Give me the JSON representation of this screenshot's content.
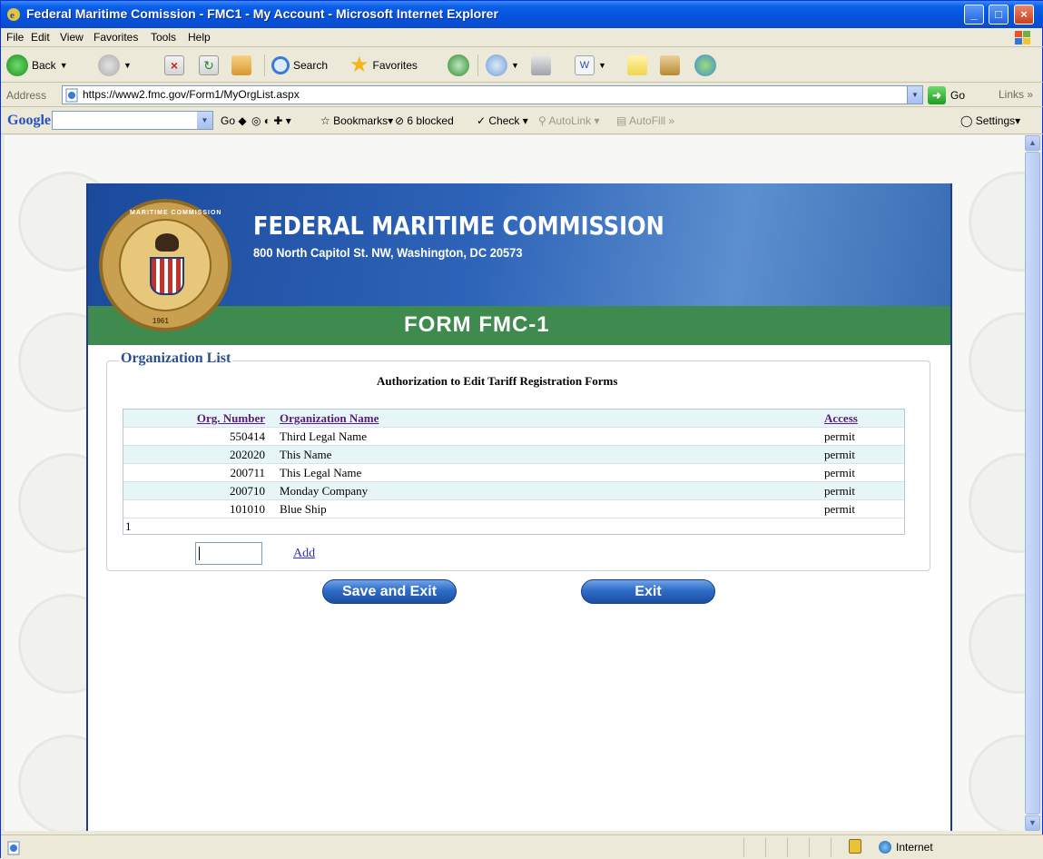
{
  "window": {
    "title": "Federal Maritime Comission - FMC1 - My Account - Microsoft Internet Explorer"
  },
  "menu": [
    "File",
    "Edit",
    "View",
    "Favorites",
    "Tools",
    "Help"
  ],
  "toolbar": {
    "back": "Back",
    "search": "Search",
    "favorites": "Favorites"
  },
  "address": {
    "label": "Address",
    "url": "https://www2.fmc.gov/Form1/MyOrgList.aspx",
    "go": "Go",
    "links": "Links"
  },
  "google": {
    "logo": "Google",
    "go": "Go",
    "bookmarks": "Bookmarks",
    "blocked": "6 blocked",
    "check": "Check",
    "autolink": "AutoLink",
    "autofill": "AutoFill",
    "settings": "Settings"
  },
  "banner": {
    "title": "FEDERAL MARITIME COMMISSION",
    "subtitle": "800 North Capitol St. NW, Washington, DC 20573",
    "form_title": "FORM FMC-1",
    "seal_text": "MARITIME COMMISSION",
    "seal_year": "1961"
  },
  "org_list": {
    "legend": "Organization List",
    "heading": "Authorization to Edit Tariff Registration Forms",
    "columns": {
      "number": "Org. Number",
      "name": "Organization Name",
      "access": "Access"
    },
    "rows": [
      {
        "number": "550414",
        "name": "Third Legal Name",
        "access": "permit"
      },
      {
        "number": "202020",
        "name": "This Name",
        "access": "permit"
      },
      {
        "number": "200711",
        "name": "This Legal Name",
        "access": "permit"
      },
      {
        "number": "200710",
        "name": "Monday Company",
        "access": "permit"
      },
      {
        "number": "101010",
        "name": "Blue Ship",
        "access": "permit"
      }
    ],
    "pager": "1",
    "add_value": "",
    "add_link": "Add"
  },
  "buttons": {
    "save_exit": "Save and Exit",
    "exit": "Exit"
  },
  "status": {
    "zone": "Internet"
  }
}
